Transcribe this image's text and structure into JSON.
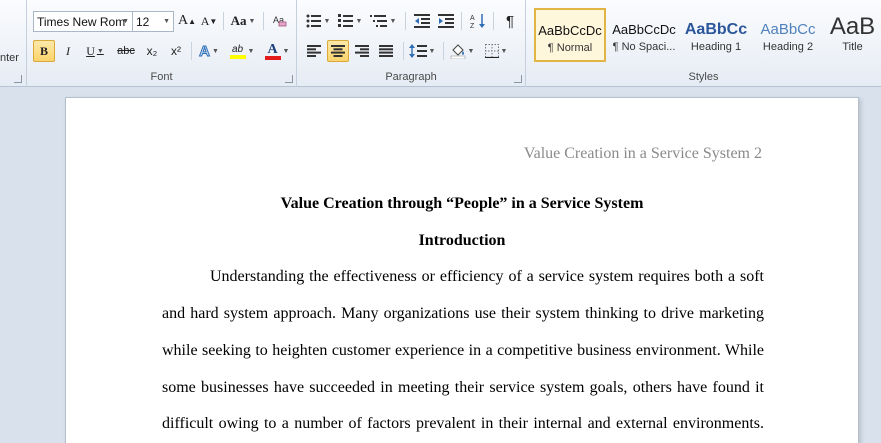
{
  "ribbon": {
    "clipboard_partial_label": "nter",
    "font": {
      "group_label": "Font",
      "font_name": "Times New Rom",
      "font_size": "12",
      "grow_label": "A",
      "shrink_label": "A",
      "change_case_label": "Aa",
      "bold_label": "B",
      "italic_label": "I",
      "underline_label": "U",
      "strike_label": "abc",
      "subscript_label": "x₂",
      "superscript_label": "x²",
      "text_effects_label": "A",
      "highlight_label": "ab",
      "font_color_label": "A",
      "highlight_color": "#ffff00",
      "font_color": "#e31b1b"
    },
    "paragraph": {
      "group_label": "Paragraph",
      "pilcrow_label": "¶"
    },
    "styles": {
      "group_label": "Styles",
      "items": [
        {
          "sample": "AaBbCcDc",
          "name": "¶ Normal"
        },
        {
          "sample": "AaBbCcDc",
          "name": "¶ No Spaci..."
        },
        {
          "sample": "AaBbCc",
          "name": "Heading 1"
        },
        {
          "sample": "AaBbCc",
          "name": "Heading 2"
        },
        {
          "sample": "AaB",
          "name": "Title"
        }
      ]
    }
  },
  "document": {
    "running_header": "Value Creation in a Service System 2",
    "title": "Value Creation through “People” in a Service System",
    "section_heading": "Introduction",
    "lines": [
      "Understanding the effectiveness or efficiency of a service system requires both a soft",
      "and hard system approach. Many organizations use their system thinking to drive marketing",
      "while seeking to heighten customer experience in a competitive business environment. While",
      "some businesses have succeeded in meeting their service system goals, others have found it",
      "difficult owing to a number of factors prevalent in their internal and external environments."
    ]
  }
}
